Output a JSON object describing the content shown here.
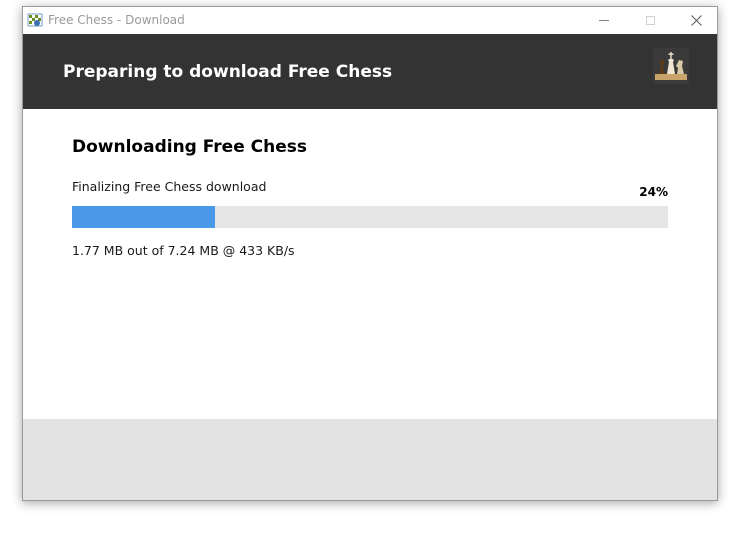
{
  "window": {
    "title": "Free Chess - Download",
    "app_icon": "chess-app-icon",
    "controls": {
      "minimize_icon": "minimize-icon",
      "maximize_icon": "maximize-icon",
      "close_icon": "close-icon",
      "close_glyph": "✕"
    }
  },
  "header": {
    "title": "Preparing to download Free Chess",
    "logo_icon": "chess-pieces-logo",
    "background_color": "#333333"
  },
  "main": {
    "section_title": "Downloading Free Chess",
    "status": "Finalizing Free Chess download",
    "progress_percent_label": "24%",
    "progress_fraction": 0.24,
    "progress_color": "#4a98e8",
    "size_text": "1.77 MB out of 7.24 MB @ 433 KB/s"
  },
  "footer": {
    "background_color": "#e3e3e3"
  }
}
